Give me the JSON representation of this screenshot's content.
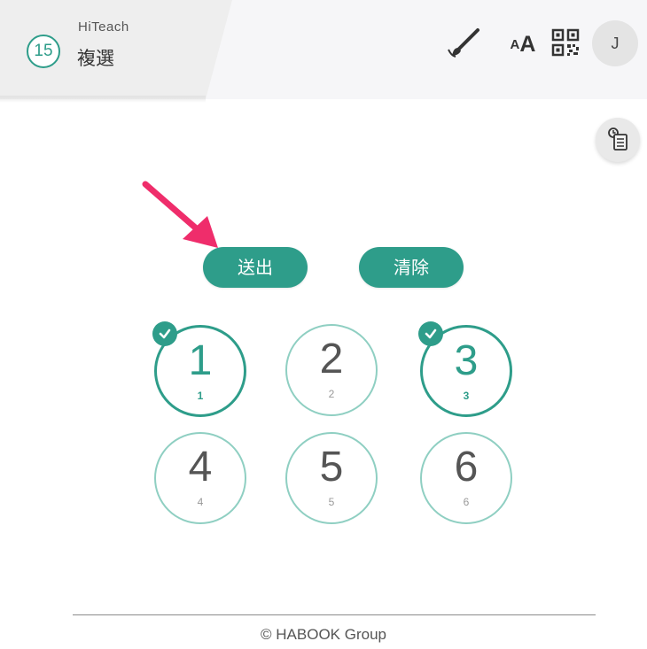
{
  "header": {
    "badge_number": "15",
    "app_name": "HiTeach",
    "mode_label": "複選",
    "icons": [
      "brush-icon",
      "font-size-icon",
      "qr-code-icon"
    ],
    "font_size_small": "A",
    "font_size_big": "A",
    "avatar_initial": "J"
  },
  "side_tool": {
    "icon": "clipboard-list-icon"
  },
  "actions": {
    "send_label": "送出",
    "clear_label": "清除"
  },
  "options": [
    {
      "number": "1",
      "sub": "1",
      "selected": true
    },
    {
      "number": "2",
      "sub": "2",
      "selected": false
    },
    {
      "number": "3",
      "sub": "3",
      "selected": true
    },
    {
      "number": "4",
      "sub": "4",
      "selected": false
    },
    {
      "number": "5",
      "sub": "5",
      "selected": false
    },
    {
      "number": "6",
      "sub": "6",
      "selected": false
    }
  ],
  "annotation": {
    "icon": "pointer-arrow-icon",
    "color": "#ef2d6b"
  },
  "footer": {
    "copyright": "© HABOOK Group"
  },
  "colors": {
    "accent": "#2e9d8a",
    "accent_light": "#8fcfc2",
    "pointer": "#ef2d6b"
  }
}
